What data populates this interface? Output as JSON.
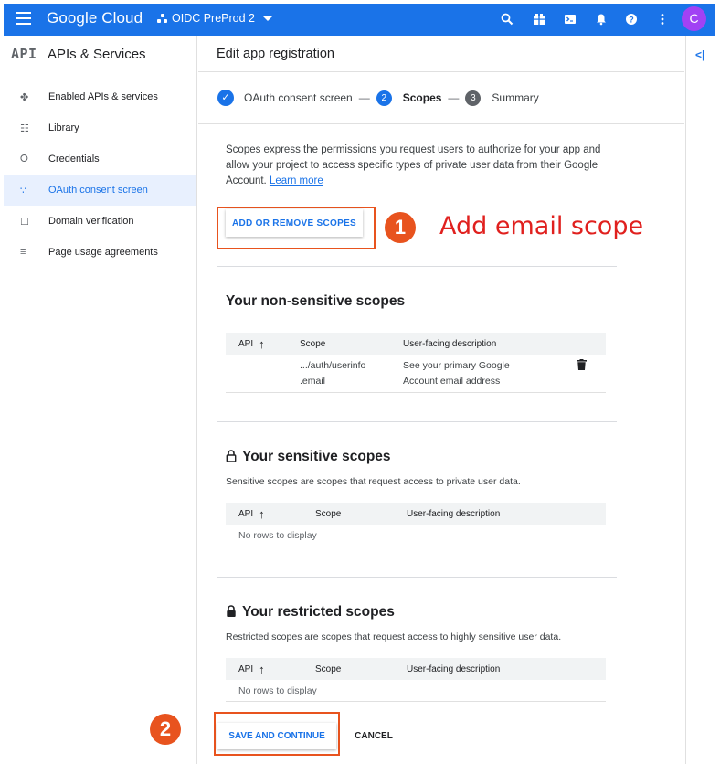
{
  "topbar": {
    "brand": "Google Cloud",
    "project": "OIDC PreProd 2",
    "avatar_letter": "C"
  },
  "sidebar": {
    "logo": "API",
    "title": "APIs & Services",
    "items": [
      {
        "label": "Enabled APIs & services",
        "icon": "✤"
      },
      {
        "label": "Library",
        "icon": "☷"
      },
      {
        "label": "Credentials",
        "icon": "⭘"
      },
      {
        "label": "OAuth consent screen",
        "icon": "∵"
      },
      {
        "label": "Domain verification",
        "icon": "☐"
      },
      {
        "label": "Page usage agreements",
        "icon": "≡"
      }
    ]
  },
  "main": {
    "page_title": "Edit app registration",
    "steps": [
      {
        "label": "OAuth consent screen",
        "state": "done"
      },
      {
        "num": "2",
        "label": "Scopes",
        "state": "current"
      },
      {
        "num": "3",
        "label": "Summary",
        "state": "todo"
      }
    ],
    "intro_text": "Scopes express the permissions you request users to authorize for your app and allow your project to access specific types of private user data from their Google Account.",
    "learn_more": "Learn more",
    "add_scopes_button": "ADD OR REMOVE SCOPES",
    "annotation_1_num": "1",
    "annotation_1_text": "Add email scope",
    "annotation_2_num": "2",
    "non_sensitive": {
      "title": "Your non-sensitive scopes",
      "columns": [
        "API",
        "Scope",
        "User-facing description"
      ],
      "rows": [
        {
          "api": "",
          "scope": ".../auth/userinfo\n.email",
          "description": "See your primary Google\nAccount email address"
        }
      ]
    },
    "sensitive": {
      "title": "Your sensitive scopes",
      "description": "Sensitive scopes are scopes that request access to private user data.",
      "columns": [
        "API",
        "Scope",
        "User-facing description"
      ],
      "empty": "No rows to display"
    },
    "restricted": {
      "title": "Your restricted scopes",
      "description": "Restricted scopes are scopes that request access to highly sensitive user data.",
      "columns": [
        "API",
        "Scope",
        "User-facing description"
      ],
      "empty": "No rows to display"
    },
    "save_button": "SAVE AND CONTINUE",
    "cancel_button": "CANCEL"
  },
  "colors": {
    "primary": "#1a73e8",
    "annotation": "#e8531e",
    "annotation_text": "#e0201e",
    "avatar": "#a142f4"
  }
}
